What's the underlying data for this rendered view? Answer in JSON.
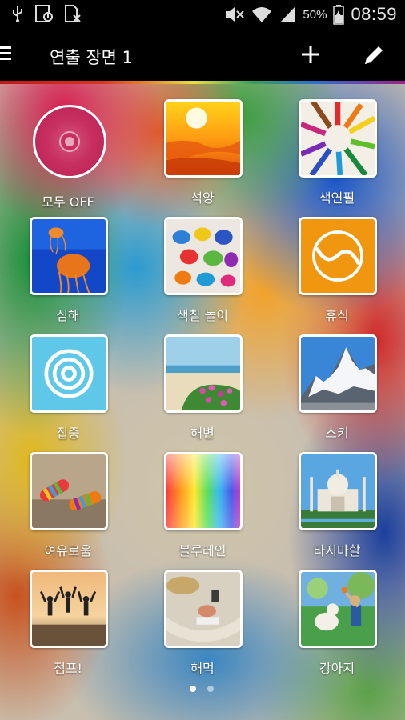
{
  "status_bar": {
    "battery_percent": "50%",
    "time": "08:59",
    "icons": [
      "usb-icon",
      "image-alert-icon",
      "sim-missing-icon",
      "mute-icon",
      "wifi-icon",
      "signal-icon",
      "battery-charging-icon"
    ]
  },
  "action_bar": {
    "title": "연출 장면 1",
    "menu_icon": "menu-icon",
    "add_icon": "add-icon",
    "edit_icon": "pencil-icon"
  },
  "scenes": [
    {
      "label": "모두 OFF",
      "icon": "all-off-icon"
    },
    {
      "label": "석양",
      "icon": "sunset-thumbnail"
    },
    {
      "label": "색연필",
      "icon": "colored-pencils-thumbnail"
    },
    {
      "label": "심해",
      "icon": "jellyfish-thumbnail"
    },
    {
      "label": "색칠 놀이",
      "icon": "handprints-thumbnail"
    },
    {
      "label": "휴식",
      "icon": "relax-thumbnail"
    },
    {
      "label": "집중",
      "icon": "focus-thumbnail"
    },
    {
      "label": "해변",
      "icon": "beach-thumbnail"
    },
    {
      "label": "스키",
      "icon": "mountain-thumbnail"
    },
    {
      "label": "여유로움",
      "icon": "socks-thumbnail"
    },
    {
      "label": "블루레인",
      "icon": "rainbow-gradient-thumbnail"
    },
    {
      "label": "타지마할",
      "icon": "taj-mahal-thumbnail"
    },
    {
      "label": "점프!",
      "icon": "jump-thumbnail"
    },
    {
      "label": "해먹",
      "icon": "hammock-thumbnail"
    },
    {
      "label": "강아지",
      "icon": "puppy-thumbnail"
    }
  ],
  "pagination": {
    "current": 1,
    "total": 2
  },
  "colors": {
    "accent_pink": "#c73061",
    "relax_orange": "#f0960f",
    "focus_cyan": "#5fc8e8"
  }
}
